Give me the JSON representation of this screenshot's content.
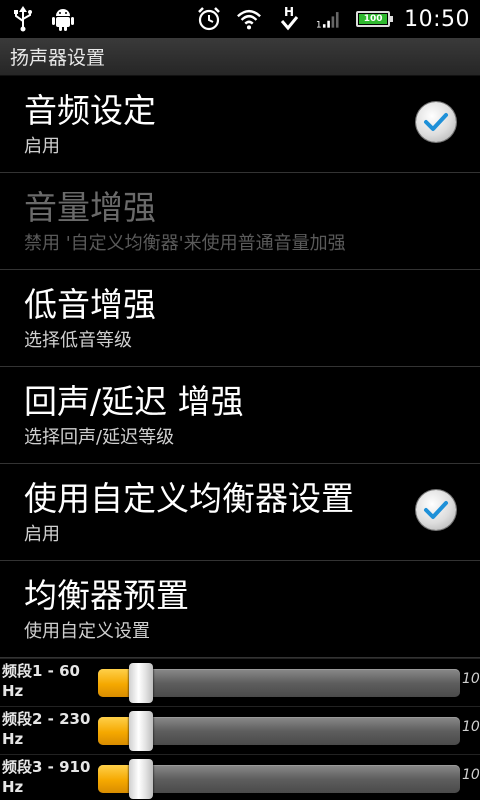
{
  "status_bar": {
    "time": "10:50",
    "battery_level": "100",
    "icons": [
      "usb-icon",
      "android-debug-icon",
      "alarm-icon",
      "wifi-icon",
      "hspa-icon",
      "signal-icon",
      "battery-icon"
    ]
  },
  "title": "扬声器设置",
  "items": [
    {
      "title": "音频设定",
      "subtitle": "启用",
      "checked": true,
      "enabled": true
    },
    {
      "title": "音量增强",
      "subtitle": "禁用 '自定义均衡器'来使用普通音量加强",
      "enabled": false
    },
    {
      "title": "低音增强",
      "subtitle": "选择低音等级",
      "enabled": true
    },
    {
      "title": "回声/延迟 增强",
      "subtitle": "选择回声/延迟等级",
      "enabled": true
    },
    {
      "title": "使用自定义均衡器设置",
      "subtitle": "启用",
      "checked": true,
      "enabled": true
    },
    {
      "title": "均衡器预置",
      "subtitle": "使用自定义设置",
      "enabled": true
    }
  ],
  "bands": [
    {
      "label": "频段1 - 60 Hz",
      "max_label": "10",
      "level": 0.12
    },
    {
      "label": "频段2 - 230 Hz",
      "max_label": "10",
      "level": 0.12
    },
    {
      "label": "频段3 - 910 Hz",
      "max_label": "10",
      "level": 0.12
    }
  ],
  "colors": {
    "accent_check": "#1e90d8",
    "slider_fill": "#f5a800",
    "battery": "#2fb82f"
  }
}
